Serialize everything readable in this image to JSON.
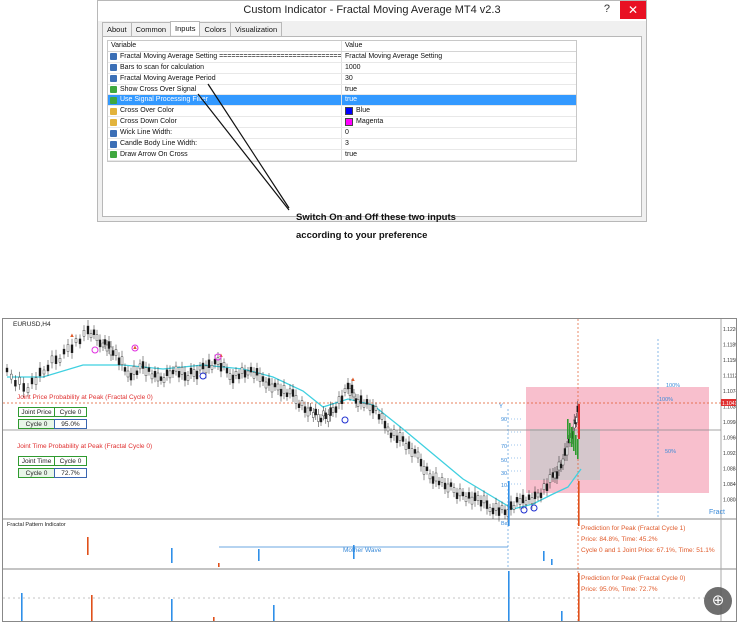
{
  "dialog": {
    "title": "Custom Indicator - Fractal Moving Average MT4 v2.3",
    "help": "?",
    "close": "✕",
    "tabs": [
      "About",
      "Common",
      "Inputs",
      "Colors",
      "Visualization"
    ],
    "active_tab": "Inputs",
    "columns": {
      "variable": "Variable",
      "value": "Value"
    },
    "rows": [
      {
        "name": "Fractal Moving Average Setting ==============================",
        "value": "Fractal Moving Average Setting",
        "icon": "num"
      },
      {
        "name": "Bars to scan for calculation",
        "value": "1000",
        "icon": "num"
      },
      {
        "name": "Fractal Moving Average Period",
        "value": "30",
        "icon": "num"
      },
      {
        "name": "Show Cross Over Signal",
        "value": "true",
        "icon": "bool"
      },
      {
        "name": "Use Signal Processing Filter",
        "value": "true",
        "icon": "bool",
        "selected": true
      },
      {
        "name": "Cross Over Color",
        "value": "Blue",
        "icon": "col",
        "swatch": "#0000ff"
      },
      {
        "name": "Cross Down Color",
        "value": "Magenta",
        "icon": "col",
        "swatch": "#ff00ff"
      },
      {
        "name": "Wick Line Width:",
        "value": "0",
        "icon": "num"
      },
      {
        "name": "Candle Body Line Width:",
        "value": "3",
        "icon": "num"
      },
      {
        "name": "Draw Arrow On Cross",
        "value": "true",
        "icon": "bool"
      }
    ]
  },
  "annotation": {
    "line1": "Switch On and Off these two inputs",
    "line2": "according to your preference"
  },
  "chart": {
    "symbol": "EURUSD,H4",
    "joint_price_title": "Joint Price Probability at Peak (Fractal Cycle 0)",
    "joint_price_label": "Joint Price",
    "joint_price_cycle": "Cycle 0",
    "joint_price_cycle_row": "Cycle 0",
    "joint_price_value": "95.0%",
    "joint_time_title": "Joint Time Probability at Peak (Fractal Cycle 0)",
    "joint_time_label": "Joint Time",
    "joint_time_cycle": "Cycle 0",
    "joint_time_cycle_row": "Cycle 0",
    "joint_time_value": "72.7%",
    "fractal_panel_title": "Fractal Pattern Indicator",
    "mother_wave": "Mother Wave",
    "fract_label": "Fract",
    "pred1_title": "Prediction for Peak (Fractal Cycle 1)",
    "pred1_line1": "Price: 84.8%, Time: 45.2%",
    "pred1_line2": "Cycle 0 and 1 Joint Price: 67.1%, Time: 51.1%",
    "pred0_title": "Prediction for Peak (Fractal Cycle 0)",
    "pred0_line1": "Price: 95.0%, Time: 72.7%",
    "pct_labels": [
      "100%",
      "100%",
      "50%"
    ],
    "level_labels": [
      "Y",
      "90",
      "70",
      "50",
      "30",
      "10",
      "Bar"
    ],
    "price_axis": [
      "1.12260",
      "1.11890",
      "1.11500",
      "1.11120",
      "1.10740",
      "1.10360",
      "1.09980",
      "1.09600",
      "1.09220",
      "1.08840",
      "1.08460",
      "1.08080"
    ],
    "current_price": "1.10410",
    "colors": {
      "up_candle": "#1a1a1a",
      "cyan_ma": "#3fd0e0",
      "pink_zone": "#f7b4c4",
      "grey_zone": "#d0c8cc",
      "blue_bar": "#2f8fe8",
      "orange_bar": "#e0501a"
    }
  }
}
